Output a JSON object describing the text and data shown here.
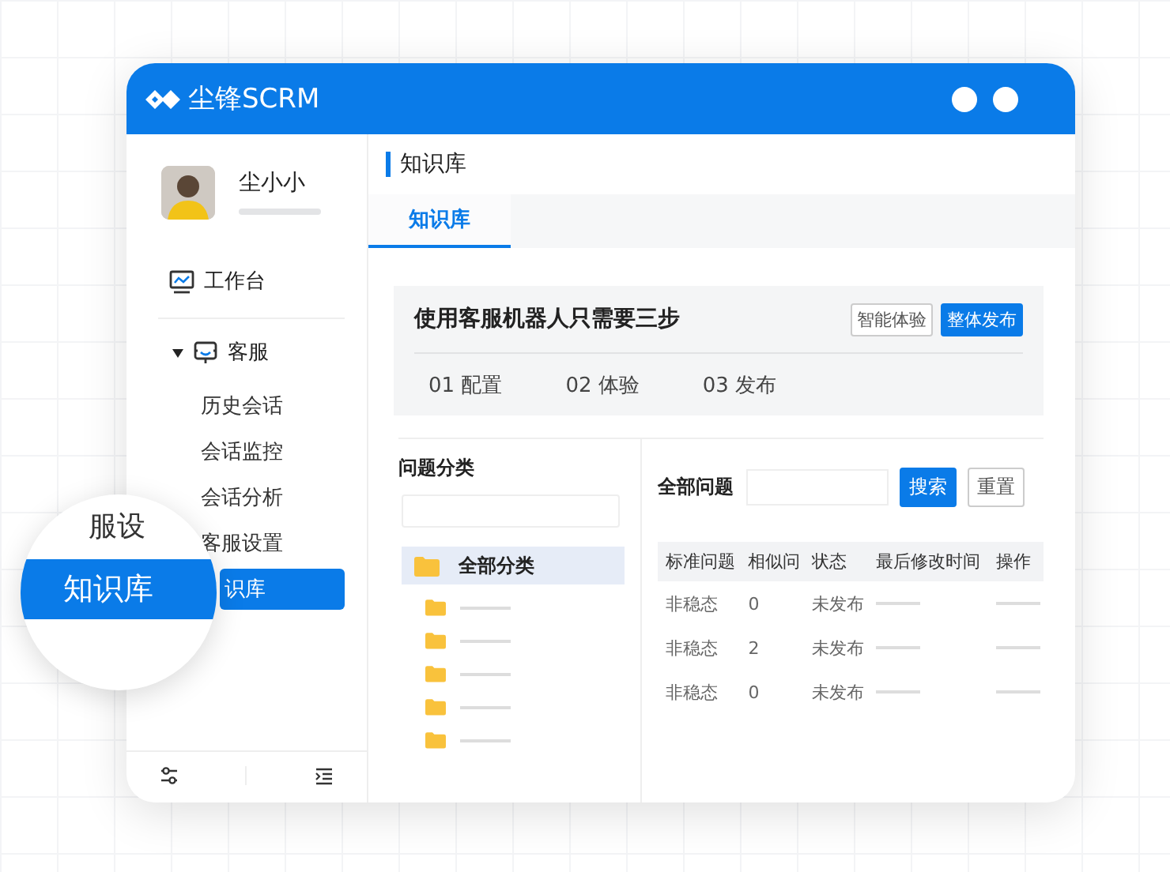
{
  "app": {
    "logo": "尘锋SCRM"
  },
  "user": {
    "name": "尘小小"
  },
  "nav": [
    {
      "kind": "dashboard",
      "label": "工作台"
    },
    {
      "kind": "group",
      "label": "客服",
      "expanded": true,
      "children": [
        {
          "label": "历史会话",
          "selected": false
        },
        {
          "label": "会话监控",
          "selected": false
        },
        {
          "label": "会话分析",
          "selected": false
        },
        {
          "label": "客服设置",
          "selected": false
        },
        {
          "label": "识库",
          "selected": true
        }
      ]
    }
  ],
  "lens": {
    "label_above": "服设",
    "label": "知识库"
  },
  "breadcrumb": "知识库",
  "tabs": [
    {
      "label": "知识库",
      "selected": true
    }
  ],
  "guide": {
    "title": "使用客服机器人只需要三步",
    "buttons": [
      {
        "label": "智能体验",
        "kind": "outline"
      },
      {
        "label": "整体发布",
        "kind": "primary"
      }
    ],
    "steps": [
      "01 配置",
      "02 体验",
      "03 发布"
    ]
  },
  "categories": {
    "title": "问题分类",
    "items": [
      {
        "label": "全部分类",
        "selected": true,
        "children": [
          {
            "kind": "placeholder"
          },
          {
            "kind": "placeholder"
          },
          {
            "kind": "placeholder"
          },
          {
            "kind": "placeholder"
          },
          {
            "kind": "placeholder"
          }
        ]
      }
    ]
  },
  "questions": {
    "title": "全部问题",
    "buttons": [
      {
        "label": "搜索",
        "kind": "primary"
      },
      {
        "label": "重置",
        "kind": "outline"
      }
    ],
    "table": {
      "columns": [
        "标准问题",
        "相似问",
        "状态",
        "最后修改时间",
        "操作"
      ],
      "rows": [
        [
          "非稳态",
          "0",
          "未发布"
        ],
        [
          "非稳态",
          "2",
          "未发布"
        ],
        [
          "非稳态",
          "0",
          "未发布"
        ]
      ]
    }
  }
}
